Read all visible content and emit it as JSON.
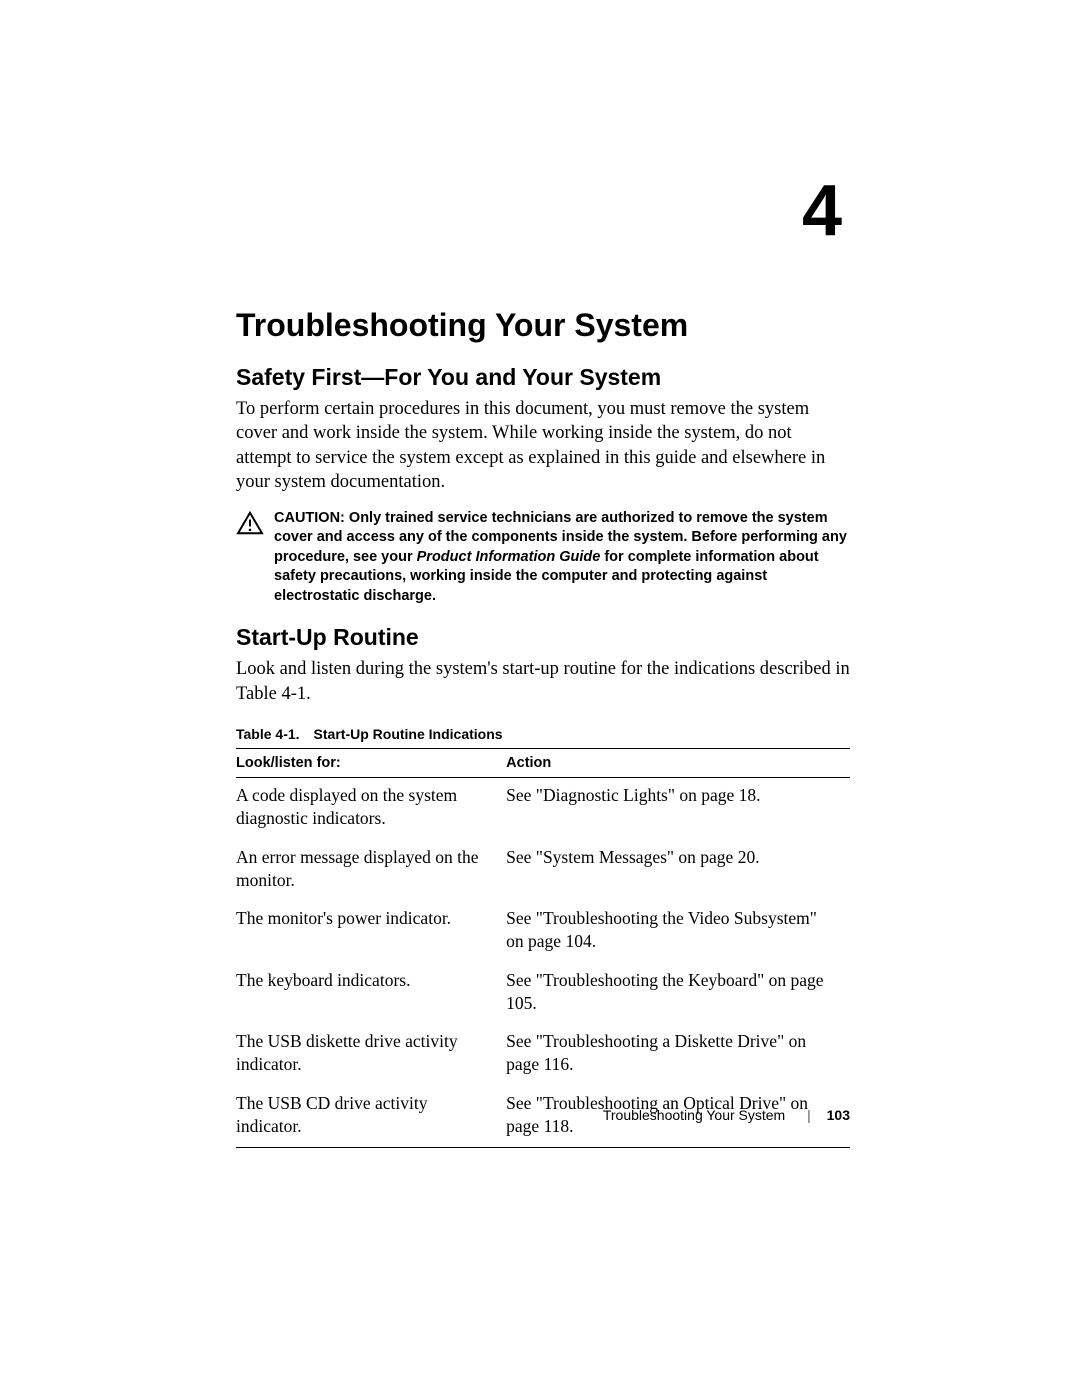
{
  "chapter": {
    "number": "4",
    "title": "Troubleshooting Your System"
  },
  "section_safety": {
    "heading": "Safety First—For You and Your System",
    "paragraph": "To perform certain procedures in this document, you must remove the system cover and work inside the system. While working inside the system, do not attempt to service the system except as explained in this guide and elsewhere in your system documentation."
  },
  "caution": {
    "label": "CAUTION:",
    "text_before_italic": " Only trained service technicians are authorized to remove the system cover and access any of the components inside the system. Before performing any procedure, see your ",
    "italic": "Product Information Guide",
    "text_after_italic": " for complete information about safety precautions, working inside the computer and protecting against electrostatic discharge."
  },
  "section_startup": {
    "heading": "Start-Up Routine",
    "paragraph": "Look and listen during the system's start-up routine for the indications described in Table 4-1."
  },
  "table": {
    "caption_label": "Table 4-1.",
    "caption_title": "Start-Up Routine Indications",
    "headers": {
      "col1": "Look/listen for:",
      "col2": "Action"
    },
    "rows": [
      {
        "look": "A code displayed on the system diagnostic indicators.",
        "action": "See \"Diagnostic Lights\" on page 18."
      },
      {
        "look": "An error message displayed on the monitor.",
        "action": "See \"System Messages\" on page 20."
      },
      {
        "look": "The monitor's power indicator.",
        "action": "See \"Troubleshooting the Video Subsystem\" on page 104."
      },
      {
        "look": "The keyboard indicators.",
        "action": "See \"Troubleshooting the Keyboard\" on page 105."
      },
      {
        "look": "The USB diskette drive activity indicator.",
        "action": "See \"Troubleshooting a Diskette Drive\" on page 116."
      },
      {
        "look": "The USB CD drive activity indicator.",
        "action": "See \"Troubleshooting an Optical Drive\" on page 118."
      }
    ]
  },
  "footer": {
    "running_title": "Troubleshooting Your System",
    "page_number": "103"
  }
}
